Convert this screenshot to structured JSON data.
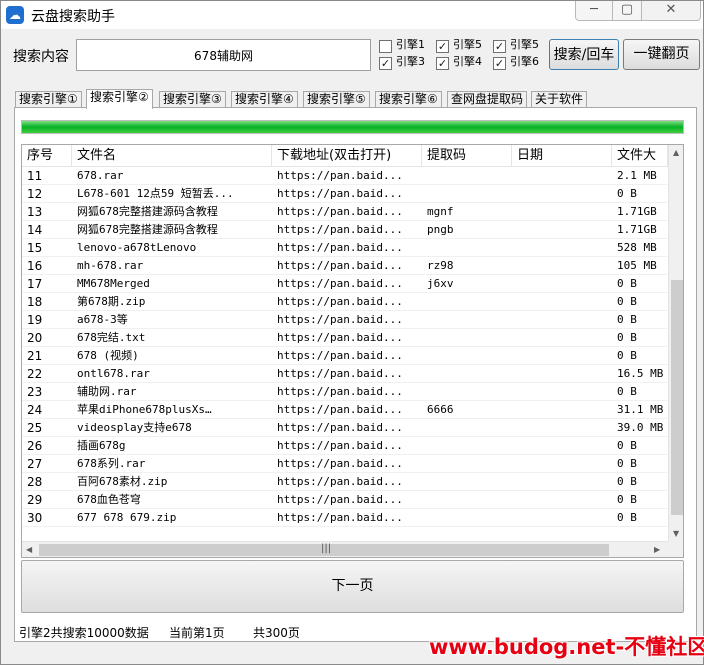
{
  "window": {
    "title": "云盘搜索助手",
    "minimize": "─",
    "maximize": "▢",
    "close": "✕",
    "app_icon": "cloud-icon"
  },
  "search": {
    "label": "搜索内容",
    "value": "678辅助网"
  },
  "engines": [
    {
      "label": "引擎1",
      "checked": false
    },
    {
      "label": "引擎3",
      "checked": true
    },
    {
      "label": "引擎5",
      "checked": true
    },
    {
      "label": "引擎4",
      "checked": true
    },
    {
      "label": "引擎5",
      "checked": true
    },
    {
      "label": "引擎6",
      "checked": true
    }
  ],
  "buttons": {
    "search_back": "搜索/回车",
    "flip_all": "一键翻页",
    "next_page": "下一页"
  },
  "tabs": [
    {
      "label": "搜索引擎①",
      "active": false
    },
    {
      "label": "搜索引擎②",
      "active": true
    },
    {
      "label": "搜索引擎③",
      "active": false
    },
    {
      "label": "搜索引擎④",
      "active": false
    },
    {
      "label": "搜索引擎⑤",
      "active": false
    },
    {
      "label": "搜索引擎⑥",
      "active": false
    },
    {
      "label": "查网盘提取码",
      "active": false
    },
    {
      "label": "关于软件",
      "active": false
    }
  ],
  "progress": 100,
  "table": {
    "columns": [
      "序号",
      "文件名",
      "下载地址(双击打开)",
      "提取码",
      "日期",
      "文件大"
    ],
    "rows": [
      [
        "11",
        "678.rar",
        "https://pan.baid...",
        "",
        "",
        "2.1 MB"
      ],
      [
        "12",
        "L678-601 12点59 短暂丢...",
        "https://pan.baid...",
        "",
        "",
        "0 B"
      ],
      [
        "13",
        "网狐678完整搭建源码含教程",
        "https://pan.baid...",
        "mgnf",
        "",
        "1.71GB"
      ],
      [
        "14",
        "网狐678完整搭建源码含教程",
        "https://pan.baid...",
        "pngb",
        "",
        "1.71GB"
      ],
      [
        "15",
        "lenovo-a678tLenovo",
        "https://pan.baid...",
        "",
        "",
        "528 MB"
      ],
      [
        "16",
        "mh-678.rar",
        "https://pan.baid...",
        "rz98",
        "",
        "105 MB"
      ],
      [
        "17",
        "MM678Merged",
        "https://pan.baid...",
        "j6xv",
        "",
        "0 B"
      ],
      [
        "18",
        "第678期.zip",
        "https://pan.baid...",
        "",
        "",
        "0 B"
      ],
      [
        "19",
        "a678-3等",
        "https://pan.baid...",
        "",
        "",
        "0 B"
      ],
      [
        "20",
        "678完结.txt",
        "https://pan.baid...",
        "",
        "",
        "0 B"
      ],
      [
        "21",
        "678 (视频)",
        "https://pan.baid...",
        "",
        "",
        "0 B"
      ],
      [
        "22",
        "ontl678.rar",
        "https://pan.baid...",
        "",
        "",
        "16.5 MB"
      ],
      [
        "23",
        "辅助网.rar",
        "https://pan.baid...",
        "",
        "",
        "0 B"
      ],
      [
        "24",
        "苹果diPhone678plusXs…",
        "https://pan.baid...",
        "6666",
        "",
        "31.1 MB"
      ],
      [
        "25",
        "videosplay支持e678",
        "https://pan.baid...",
        "",
        "",
        "39.0 MB"
      ],
      [
        "26",
        "插画678g",
        "https://pan.baid...",
        "",
        "",
        "0 B"
      ],
      [
        "27",
        "678系列.rar",
        "https://pan.baid...",
        "",
        "",
        "0 B"
      ],
      [
        "28",
        "百阿678素材.zip",
        "https://pan.baid...",
        "",
        "",
        "0 B"
      ],
      [
        "29",
        "678血色苍穹",
        "https://pan.baid...",
        "",
        "",
        "0 B"
      ],
      [
        "30",
        "677 678 679.zip",
        "https://pan.baid...",
        "",
        "",
        "0 B"
      ]
    ]
  },
  "status": {
    "total": "引擎2共搜索10000数据",
    "current": "当前第1页",
    "pages": "共300页"
  },
  "watermark": {
    "url": "www.budog.net",
    "separator": "-",
    "name": "不懂社区"
  },
  "colors": {
    "progress": "#06b025",
    "watermark": "#e60012",
    "accent": "#3c7fb1"
  }
}
